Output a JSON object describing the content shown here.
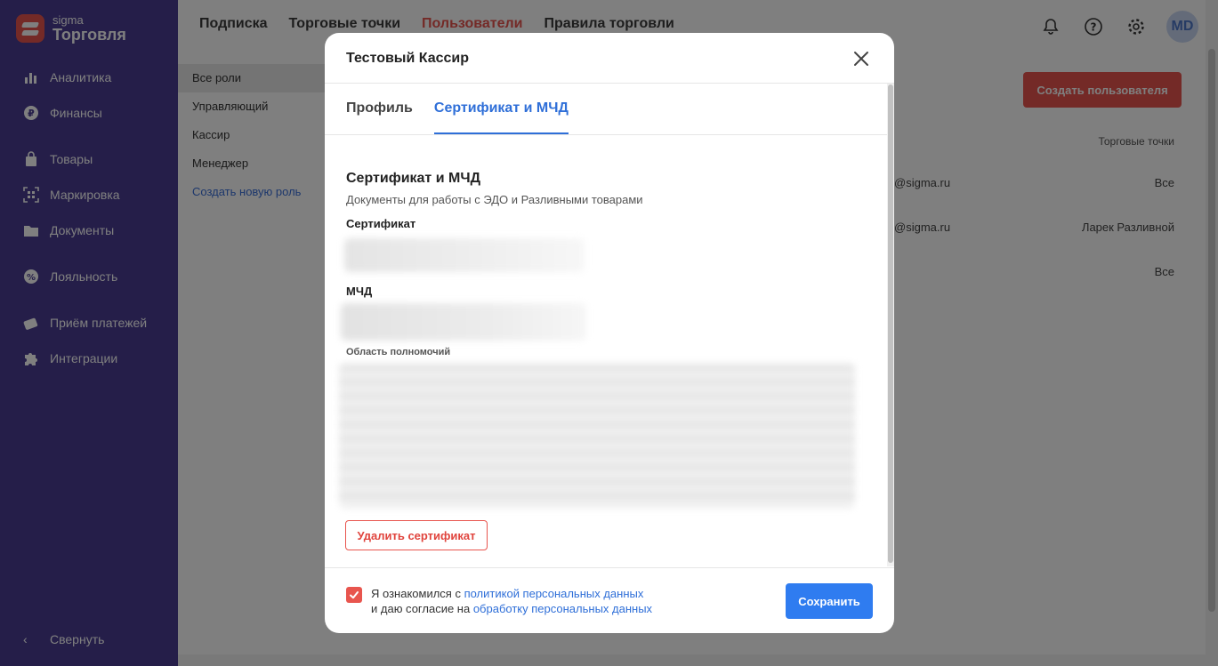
{
  "brand": {
    "small": "sigma",
    "big": "Торговля"
  },
  "sidebar": {
    "items": [
      {
        "label": "Аналитика",
        "icon": "bar-chart-icon"
      },
      {
        "label": "Финансы",
        "icon": "ruble-icon"
      },
      {
        "label": "Товары",
        "icon": "bag-icon"
      },
      {
        "label": "Маркировка",
        "icon": "datamatrix-icon"
      },
      {
        "label": "Документы",
        "icon": "folder-icon"
      },
      {
        "label": "Лояльность",
        "icon": "percent-icon"
      },
      {
        "label": "Приём платежей",
        "icon": "card-icon"
      },
      {
        "label": "Интеграции",
        "icon": "puzzle-icon"
      }
    ],
    "collapse_label": "Свернуть"
  },
  "topnav": {
    "items": [
      "Подписка",
      "Торговые точки",
      "Пользователи",
      "Правила торговли"
    ],
    "active": "Пользователи"
  },
  "user": {
    "initials": "MD"
  },
  "roles": [
    "Все роли",
    "Управляющий",
    "Кассир",
    "Менеджер"
  ],
  "roles_create": "Создать новую роль",
  "users_page": {
    "create_button": "Создать пользователя",
    "column_stores": "Торговые точки",
    "rows": [
      {
        "email": "@sigma.ru",
        "stores": "Все"
      },
      {
        "email": "@sigma.ru",
        "stores": "Ларек Разливной"
      },
      {
        "email": "",
        "stores": "Все"
      }
    ]
  },
  "modal": {
    "title": "Тестовый Кассир",
    "tabs": [
      "Профиль",
      "Сертификат и МЧД"
    ],
    "active_tab": "Сертификат и МЧД",
    "section_title": "Сертификат и МЧД",
    "section_subtitle": "Документы для работы с ЭДО и Разливными товарами",
    "certificate_label": "Сертификат",
    "mcd_label": "МЧД",
    "scope_label": "Область полномочий",
    "delete_button": "Удалить сертификат",
    "consent": {
      "part1": "Я ознакомился с ",
      "link1": "политикой персональных данных",
      "part2": "и даю согласие на ",
      "link2": "обработку персональных данных",
      "checked": true
    },
    "save_button": "Сохранить"
  },
  "colors": {
    "accent_red": "#e8554e",
    "accent_blue": "#2f7cf0",
    "sidebar": "#4a3d93"
  }
}
